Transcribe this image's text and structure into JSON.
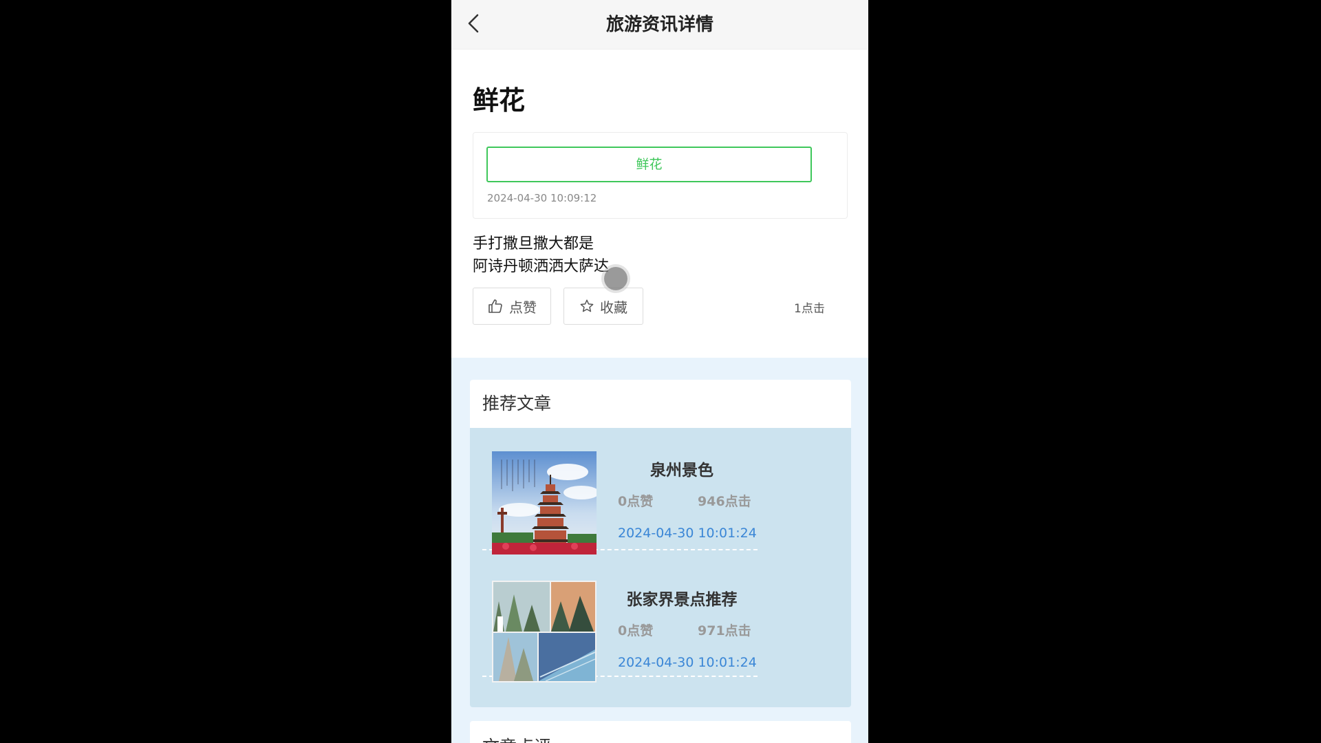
{
  "navbar": {
    "title": "旅游资讯详情",
    "back_icon": "chevron-left-icon"
  },
  "article": {
    "title": "鲜花",
    "tag": "鲜花",
    "time": "2024-04-30 10:09:12",
    "body": [
      "手打撒旦撒大都是",
      "阿诗丹顿洒洒大萨达"
    ],
    "like_label": "点赞",
    "favorite_label": "收藏",
    "click_count": "1点击"
  },
  "recommend": {
    "title": "推荐文章",
    "items": [
      {
        "title": "泉州景色",
        "likes": "0点赞",
        "clicks": "946点击",
        "time": "2024-04-30 10:01:24"
      },
      {
        "title": "张家界景点推荐",
        "likes": "0点赞",
        "clicks": "971点击",
        "time": "2024-04-30 10:01:24"
      }
    ]
  },
  "next_section": {
    "title": "文章点评"
  },
  "colors": {
    "accent_green": "#3ec75a",
    "time_blue": "#3a86d6",
    "rec_bg": "#cce3ef"
  }
}
